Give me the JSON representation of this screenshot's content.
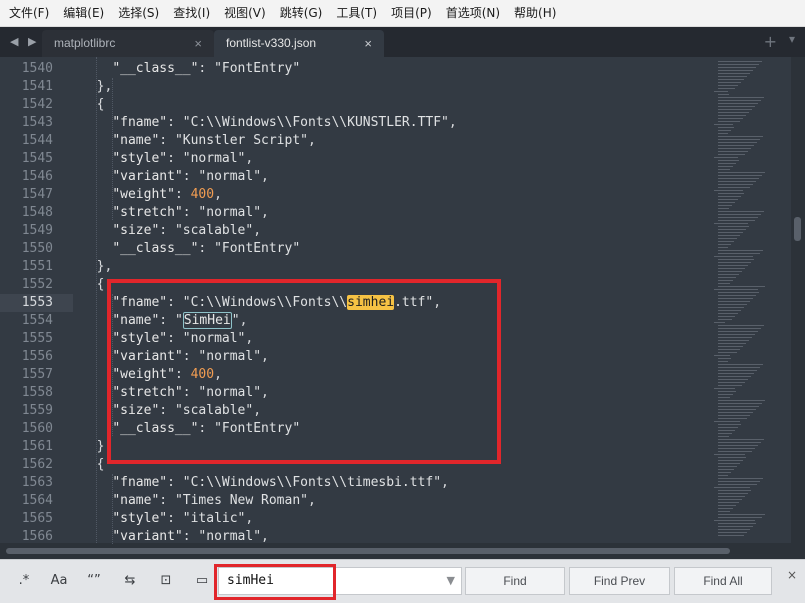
{
  "menu": [
    "文件(F)",
    "编辑(E)",
    "选择(S)",
    "查找(I)",
    "视图(V)",
    "跳转(G)",
    "工具(T)",
    "项目(P)",
    "首选项(N)",
    "帮助(H)"
  ],
  "tabs": [
    {
      "label": "matplotlibrc",
      "active": false
    },
    {
      "label": "fontlist-v330.json",
      "active": true
    }
  ],
  "editor": {
    "active_line": 1553,
    "line_numbers": [
      1540,
      1541,
      1542,
      1543,
      1544,
      1545,
      1546,
      1547,
      1548,
      1549,
      1550,
      1551,
      1552,
      1553,
      1554,
      1555,
      1556,
      1557,
      1558,
      1559,
      1560,
      1561,
      1562,
      1563,
      1564,
      1565,
      1566
    ],
    "lines": [
      "    \"__class__\": \"FontEntry\"",
      "  },",
      "  {",
      "    \"fname\": \"C:\\\\Windows\\\\Fonts\\\\KUNSTLER.TTF\",",
      "    \"name\": \"Kunstler Script\",",
      "    \"style\": \"normal\",",
      "    \"variant\": \"normal\",",
      "    \"weight\": 400,",
      "    \"stretch\": \"normal\",",
      "    \"size\": \"scalable\",",
      "    \"__class__\": \"FontEntry\"",
      "  },",
      "  {",
      "    \"fname\": \"C:\\\\Windows\\\\Fonts\\\\simhei.ttf\",",
      "    \"name\": \"SimHei\",",
      "    \"style\": \"normal\",",
      "    \"variant\": \"normal\",",
      "    \"weight\": 400,",
      "    \"stretch\": \"normal\",",
      "    \"size\": \"scalable\",",
      "    \"__class__\": \"FontEntry\"",
      "  },",
      "  {",
      "    \"fname\": \"C:\\\\Windows\\\\Fonts\\\\timesbi.ttf\",",
      "    \"name\": \"Times New Roman\",",
      "    \"style\": \"italic\",",
      "    \"variant\": \"normal\","
    ],
    "highlight_term": "simhei",
    "boxed_term": "SimHei"
  },
  "find": {
    "options": [
      ".*",
      "Aa",
      "“”",
      "⇆",
      "⊡",
      "▭"
    ],
    "query": "simHei",
    "buttons": {
      "find": "Find",
      "find_prev": "Find Prev",
      "find_all": "Find All"
    },
    "close": "×"
  },
  "icons": {
    "tab_nav": "◀ ▶",
    "tab_close": "×",
    "new_tab": "+",
    "tab_menu": "▾",
    "dropdown": "▼"
  },
  "colors": {
    "editor_bg": "#333a43",
    "highlight": "#f6c244",
    "number": "#f29d52",
    "annotation_red": "#e1262b"
  }
}
